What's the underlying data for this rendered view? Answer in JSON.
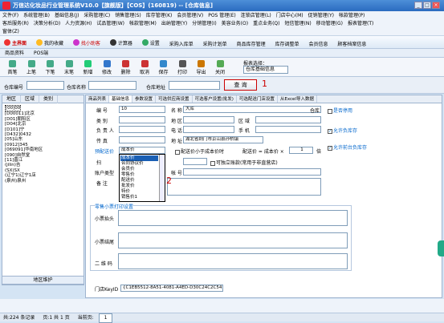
{
  "window": {
    "title": "万信达化妆品行业管理系统V10.0【旗舰版】【COS】(160819)  -- [仓库信息]"
  },
  "menu1": [
    "文件(F)",
    "系统管理(B)",
    "基础信息(J)",
    "采购管理(C)",
    "销售管理(S)",
    "库存管理(K)",
    "会员管理(V)",
    "POS 管理(E)",
    "连锁店管理(L)",
    "门店中心(M)",
    "促销管理(Y)",
    "帐款管理(P)"
  ],
  "menu2": [
    "客后服务(R)",
    "决策分析(D)",
    "人力资源(H)",
    "试品管理(W)",
    "帐款管理(M)",
    "出纳管理(Y)",
    "分销管理(I)",
    "美容业务(O)",
    "重点业务(Q)",
    "短信管理(N)",
    "移动管理(G)",
    "报表管理(T)"
  ],
  "menu3": [
    "窗体(Z)"
  ],
  "toolbar1": {
    "home": "主界面",
    "fav": "我的收藏",
    "find": "找小助客",
    "calc": "计算器",
    "settings": "设置",
    "purchase": "采购入库单",
    "plan": "采购计划单",
    "goods_archive": "商品库存管理",
    "adjust": "库存调整单",
    "member": "会员信息",
    "customer": "顾客档案信息"
  },
  "tabs": [
    "商品资料",
    "POS端"
  ],
  "toolbar2": [
    "首笔",
    "上笔",
    "下笔",
    "末笔",
    "新增",
    "修改",
    "删除",
    "取消",
    "保存",
    "打印",
    "导出",
    "关闭"
  ],
  "report": {
    "label": "报表选择：",
    "value": "仓库基础信息"
  },
  "filter": {
    "wh_code": "仓库编号",
    "wh_name": "仓库名称",
    "wh_addr": "仓库地址",
    "query": "查 询",
    "marker1": "1"
  },
  "left": {
    "tabs": [
      "地区",
      "区域",
      "类别"
    ],
    "tree": [
      "[00]00",
      "[D00011]北京",
      "[D01]朝阳区",
      "[D04]北京",
      "[D101]宁",
      "[D432]0432",
      "[05]山东",
      "[0912]345",
      "[069091]华南地区",
      "[090]自然堂",
      "[11]晋江",
      "(jilin)吉",
      "(SX)SX",
      "(辽宁1)辽宁1店",
      "(泉州)泉州"
    ],
    "region_btn": "地区维护"
  },
  "right": {
    "tabs": [
      "商品列表",
      "基础信息",
      "参数设置",
      "可选供应商设置",
      "可选客户设置(批发)",
      "可选配送门店设置",
      "从Excel导入数据"
    ]
  },
  "form": {
    "code_lbl": "编 号",
    "code": "10",
    "name_lbl": "名 称",
    "name": "大库",
    "name_suffix": "仓库",
    "type_lbl": "类 别",
    "area_lbl": "地 区",
    "zone_lbl": "区 域",
    "person_lbl": "负 责 人",
    "phone_lbl": "电 话",
    "mobile_lbl": "手 机",
    "fax_lbl": "传 真",
    "addr_lbl": "地 址",
    "addr": "湖北省荆门市京山县孙桥镇",
    "price_lbl": "预配送价",
    "price_val": "成本价",
    "cfg_text": "配送价小于成本价时",
    "ratio_text": "配送价 = 成本价 ×",
    "ratio": "1",
    "ratio_suffix": "倍",
    "scan_lbl": "扫",
    "acct_lbl": "账户类型",
    "bank_lbl": "帐 号",
    "memo_lbl": "备 注",
    "independent": "可独立账款(常用于非直营店)",
    "stop": "是否停用",
    "allow_neg": "允许负库存",
    "allow_bulk": "允许前台负库存",
    "receipt_title": "零售小票打印设置",
    "receipt_head": "小票抬头",
    "receipt_tail": "小票结尾",
    "qrcode": "二 维 码",
    "key_lbl": "门店KeyID",
    "key": "{C1EB5512-8A51-4081-A4ED-D30C24C2C541}",
    "marker2": "2"
  },
  "dropdown": [
    "成本价",
    "合同协议价",
    "会员价",
    "零售价",
    "配送价",
    "批发价",
    "特价",
    "销售价1"
  ],
  "status": {
    "count": "共:224 条记录",
    "page": "页:1 共 1 页",
    "current": "当前页:",
    "current_val": "1"
  }
}
